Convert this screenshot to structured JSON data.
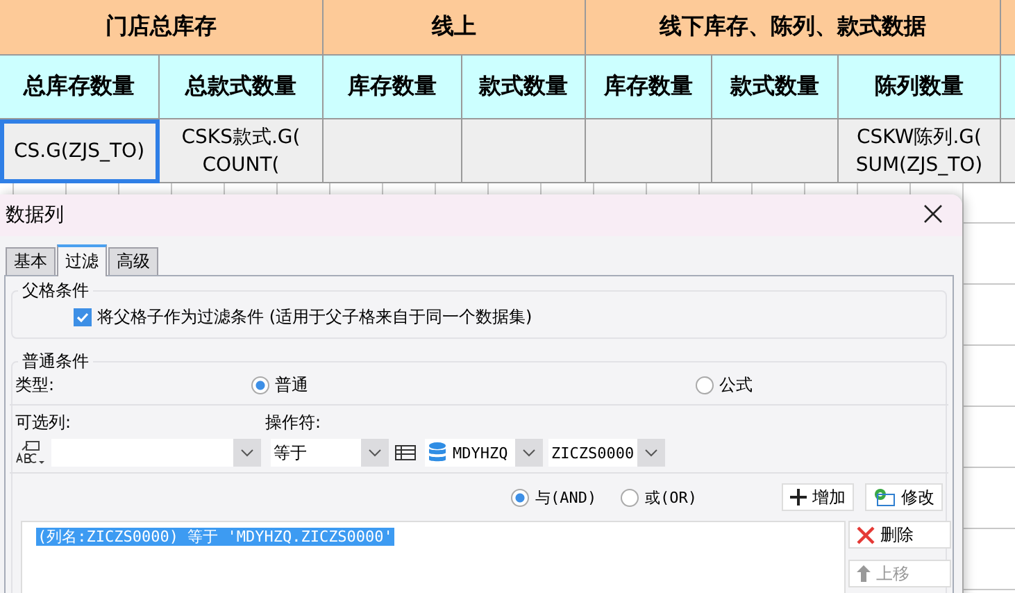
{
  "spreadsheet": {
    "group_headers": [
      {
        "label": "门店总库存"
      },
      {
        "label": "线上"
      },
      {
        "label": "线下库存、陈列、款式数据"
      }
    ],
    "column_headers": [
      "总库存数量",
      "总款式数量",
      "库存数量",
      "款式数量",
      "库存数量",
      "款式数量",
      "陈列数量"
    ],
    "cells": [
      {
        "lines": [
          "CS.G(ZJS_TO)"
        ],
        "selected": true
      },
      {
        "lines": [
          "CSKS款式.G(",
          "COUNT("
        ],
        "selected": false
      },
      {
        "selected": false
      },
      {
        "selected": false
      },
      {
        "selected": false
      },
      {
        "selected": false
      },
      {
        "lines": [
          "CSKW陈列.G(",
          "SUM(ZJS_TO)"
        ],
        "selected": false
      }
    ]
  },
  "dialog": {
    "title": "数据列",
    "tabs": [
      {
        "label": "基本",
        "selected": false
      },
      {
        "label": "过滤",
        "selected": true
      },
      {
        "label": "高级",
        "selected": false
      }
    ],
    "parent_condition": {
      "legend": "父格条件",
      "checkbox": {
        "label": "将父格子作为过滤条件 (适用于父子格来自于同一个数据集)",
        "checked": true
      }
    },
    "normal_condition": {
      "legend": "普通条件",
      "type_label": "类型:",
      "type_options": [
        {
          "label": "普通",
          "selected": true
        },
        {
          "label": "公式",
          "selected": false
        }
      ],
      "column_label": "可选列:",
      "operator_label": "操作符:",
      "operator_value": "等于",
      "dataset_value": "MDYHZQ",
      "field_value": "ZICZS0000",
      "logic_options": [
        {
          "label": "与(AND)",
          "selected": true
        },
        {
          "label": "或(OR)",
          "selected": false
        }
      ],
      "add_button": "增加",
      "edit_button": "修改",
      "conditions": [
        {
          "text": "(列名:ZICZS0000) 等于 'MDYHZQ.ZICZS0000'",
          "selected": true
        }
      ],
      "delete_button": "删除",
      "up_button": "上移"
    }
  }
}
